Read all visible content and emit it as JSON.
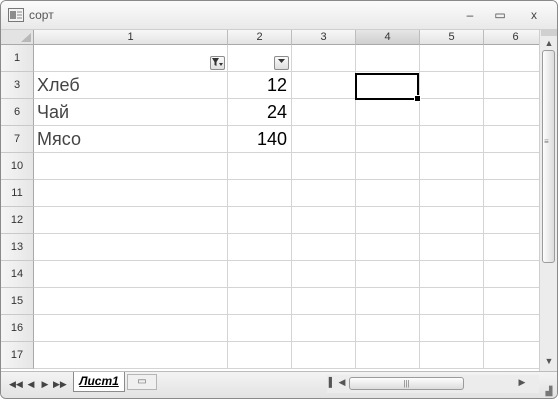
{
  "window": {
    "title": "сорт",
    "controls": {
      "minimize": "–",
      "restore": "▭",
      "close": "x"
    }
  },
  "grid": {
    "columns": [
      "1",
      "2",
      "3",
      "4",
      "5",
      "6"
    ],
    "selected_column": "4",
    "rows": [
      {
        "header": "1",
        "a": "",
        "b": ""
      },
      {
        "header": "3",
        "a": "Хлеб",
        "b": "12"
      },
      {
        "header": "6",
        "a": "Чай",
        "b": "24"
      },
      {
        "header": "7",
        "a": "Мясо",
        "b": "140"
      },
      {
        "header": "10",
        "a": "",
        "b": ""
      },
      {
        "header": "11",
        "a": "",
        "b": ""
      },
      {
        "header": "12",
        "a": "",
        "b": ""
      },
      {
        "header": "13",
        "a": "",
        "b": ""
      },
      {
        "header": "14",
        "a": "",
        "b": ""
      },
      {
        "header": "15",
        "a": "",
        "b": ""
      },
      {
        "header": "16",
        "a": "",
        "b": ""
      },
      {
        "header": "17",
        "a": "",
        "b": ""
      }
    ]
  },
  "sheets": {
    "active": "Лист1",
    "nav": [
      "◀◀",
      "◀",
      "▶",
      "▶▶"
    ]
  }
}
